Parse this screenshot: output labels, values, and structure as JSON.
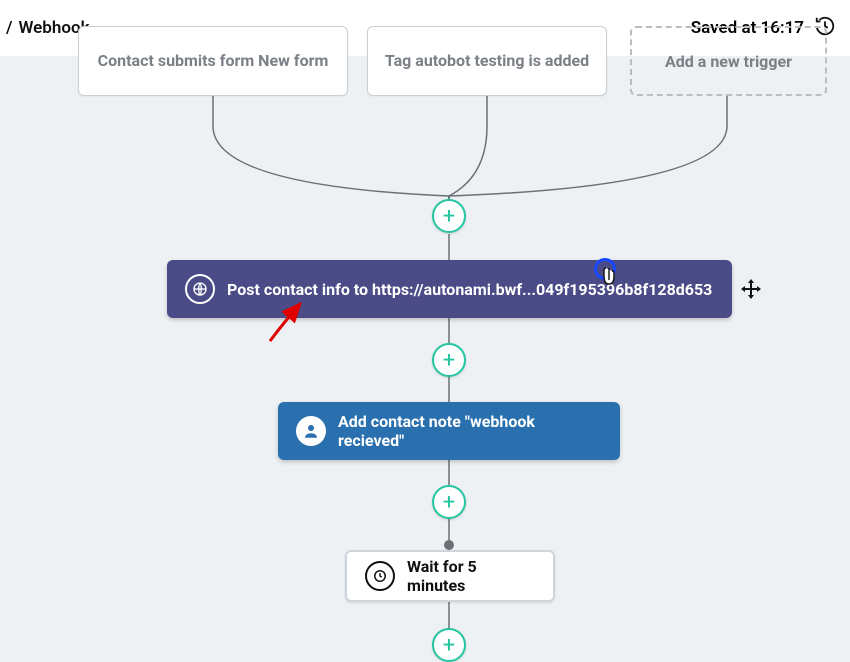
{
  "header": {
    "breadcrumb_prefix": "/",
    "breadcrumb_title": "Webhook",
    "saved_label": "Saved at 16:17"
  },
  "triggers": {
    "card1": "Contact submits form New form",
    "card2": "Tag autobot testing is added",
    "add_label": "Add a new trigger"
  },
  "steps": {
    "webhook_label": "Post contact info to https://autonami.bwf...049f195396b8f128d653",
    "note_label": "Add contact note \"webhook recieved\"",
    "wait_label": "Wait for 5 minutes"
  },
  "colors": {
    "canvas_bg": "#eef1f3",
    "webhook_bg": "#4b4b87",
    "note_bg": "#2a70ae",
    "plus_accent": "#26c5a2"
  }
}
